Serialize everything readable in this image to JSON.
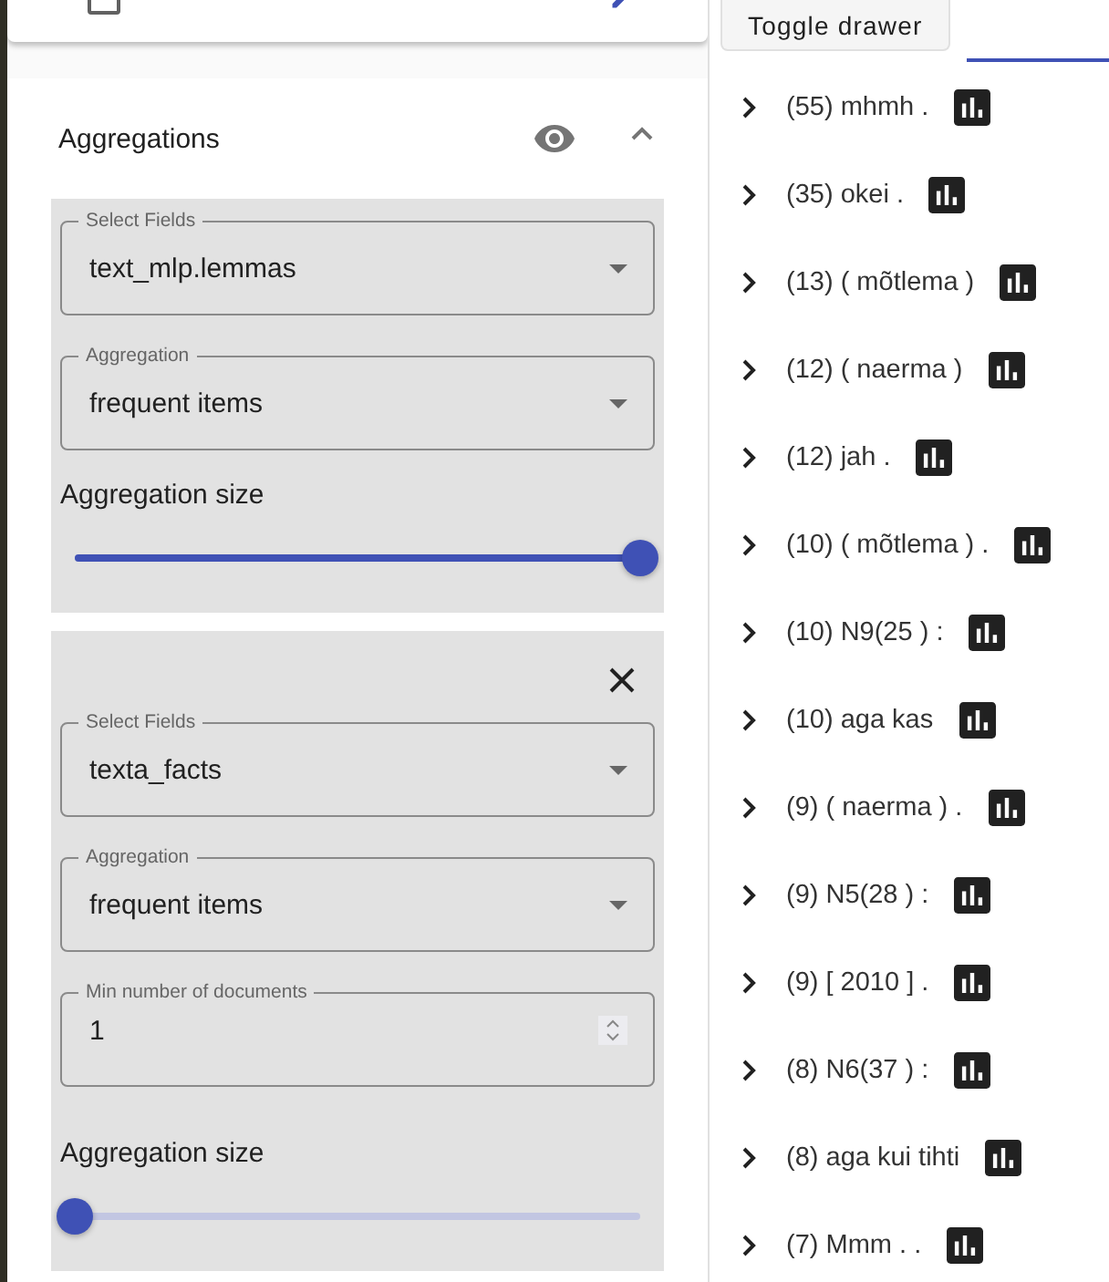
{
  "top_card": {
    "checked": false
  },
  "aggregations": {
    "title": "Aggregations",
    "expanded": true,
    "items": [
      {
        "removable": false,
        "fields": [
          {
            "kind": "select",
            "label": "Select Fields",
            "value": "text_mlp.lemmas"
          },
          {
            "kind": "select",
            "label": "Aggregation",
            "value": "frequent items"
          }
        ],
        "size_label": "Aggregation size",
        "level": 1
      },
      {
        "removable": true,
        "fields": [
          {
            "kind": "select",
            "label": "Select Fields",
            "value": "texta_facts"
          },
          {
            "kind": "select",
            "label": "Aggregation",
            "value": "frequent items"
          },
          {
            "kind": "number",
            "label": "Min number of documents",
            "value": "1"
          }
        ],
        "size_label": "Aggregation size",
        "level": 0
      }
    ]
  },
  "toggle_button": "Toggle drawer",
  "results": [
    {
      "label": "(55) mhmh ."
    },
    {
      "label": "(35) okei ."
    },
    {
      "label": "(13) ( mõtlema )"
    },
    {
      "label": "(12) ( naerma )"
    },
    {
      "label": "(12) jah ."
    },
    {
      "label": "(10) ( mõtlema ) ."
    },
    {
      "label": "(10) N9(25 ) :"
    },
    {
      "label": "(10) aga kas"
    },
    {
      "label": "(9) ( naerma ) ."
    },
    {
      "label": "(9) N5(28 ) :"
    },
    {
      "label": "(9) [ 2010 ] ."
    },
    {
      "label": "(8) N6(37 ) :"
    },
    {
      "label": "(8) aga kui tihti"
    },
    {
      "label": "(7) Mmm . ."
    }
  ]
}
